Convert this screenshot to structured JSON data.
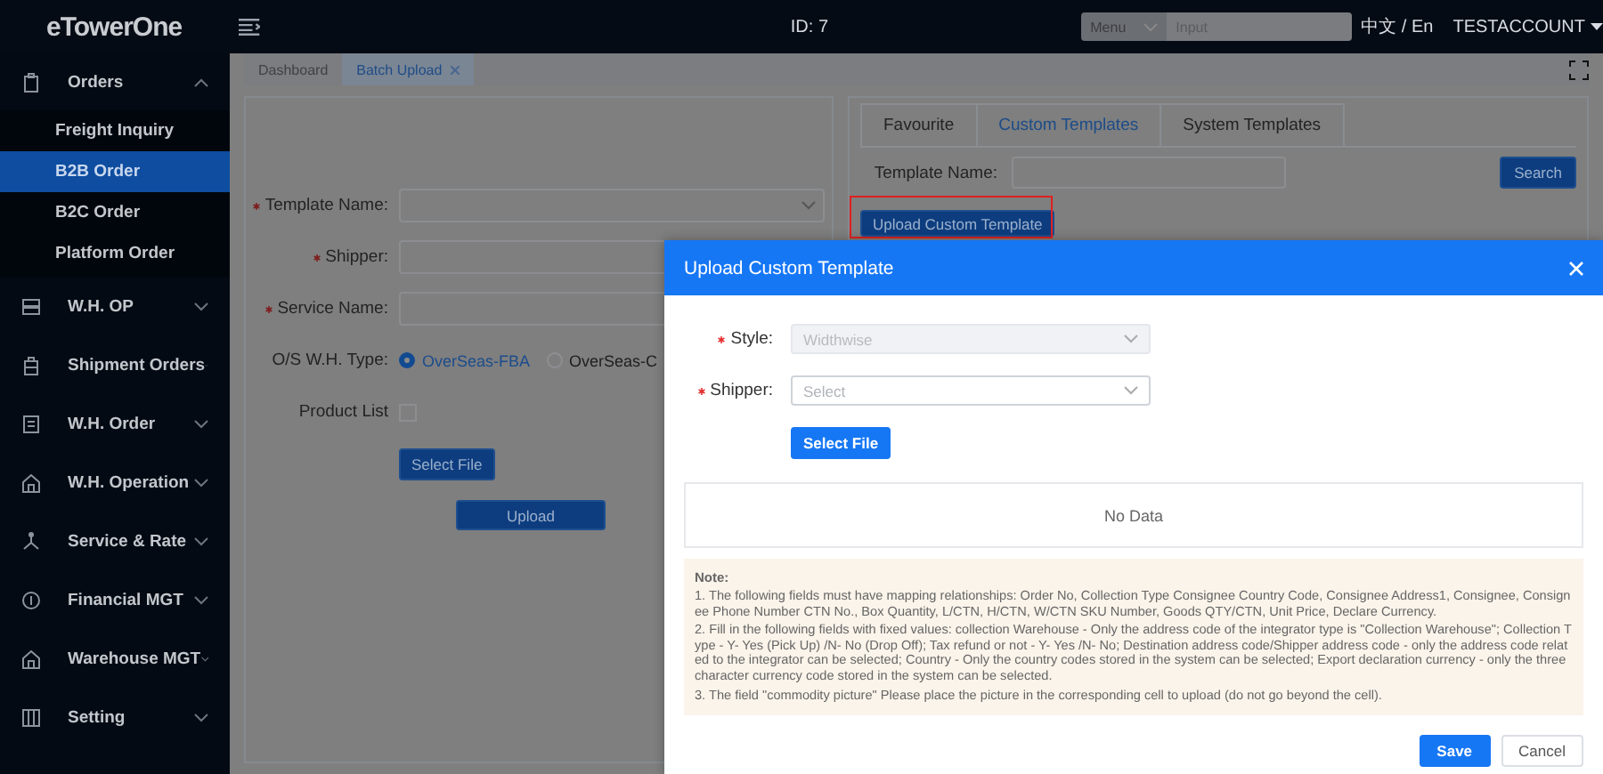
{
  "header": {
    "logo": "eTowerOne",
    "id_label": "ID: 7",
    "search": {
      "menu": "Menu",
      "placeholder": "Input"
    },
    "language": "中文 / En",
    "account": "TESTACCOUNT"
  },
  "sidebar": {
    "items": [
      {
        "label": "Orders",
        "expanded": true,
        "children": [
          {
            "label": "Freight Inquiry",
            "selected": false
          },
          {
            "label": "B2B Order",
            "selected": true
          },
          {
            "label": "B2C Order",
            "selected": false
          },
          {
            "label": "Platform Order",
            "selected": false
          }
        ]
      },
      {
        "label": "W.H. OP",
        "expanded": false
      },
      {
        "label": "Shipment Orders",
        "expanded": false
      },
      {
        "label": "W.H. Order",
        "expanded": false
      },
      {
        "label": "W.H. Operation",
        "expanded": false
      },
      {
        "label": "Service & Rate",
        "expanded": false
      },
      {
        "label": "Financial MGT",
        "expanded": false
      },
      {
        "label": "Warehouse MGT",
        "expanded": false
      },
      {
        "label": "Setting",
        "expanded": false
      }
    ]
  },
  "tabs": [
    {
      "label": "Dashboard",
      "selected": false,
      "closable": false
    },
    {
      "label": "Batch Upload",
      "selected": true,
      "closable": true
    }
  ],
  "form": {
    "fields": [
      {
        "label": "Template Name:",
        "required": true
      },
      {
        "label": "Shipper:",
        "required": true
      },
      {
        "label": "Service Name:",
        "required": true
      }
    ],
    "wh_type": {
      "label": "O/S W.H. Type:",
      "options": [
        {
          "label": "OverSeas-FBA",
          "selected": true
        },
        {
          "label": "OverSeas-C",
          "selected": false
        }
      ]
    },
    "product_list": {
      "label": "Product List",
      "checked": false
    },
    "select_file": "Select File",
    "upload": "Upload"
  },
  "templates": {
    "tabs": [
      {
        "label": "Favourite",
        "selected": false
      },
      {
        "label": "Custom Templates",
        "selected": true
      },
      {
        "label": "System Templates",
        "selected": false
      }
    ],
    "name_label": "Template Name:",
    "search": "Search",
    "upload_custom": "Upload Custom Template"
  },
  "dialog": {
    "title": "Upload Custom Template",
    "fields": [
      {
        "label": "Style:",
        "required": true,
        "value": "Widthwise",
        "disabled": true
      },
      {
        "label": "Shipper:",
        "required": true,
        "placeholder": "Select",
        "disabled": false
      }
    ],
    "select_file": "Select File",
    "empty": "No Data",
    "note_title": "Note:",
    "notes": [
      "1. The following fields must have mapping relationships: Order No, Collection Type Consignee Country Code, Consignee Address1, Consignee, Consignee Phone Number CTN No., Box Quantity, L/CTN, H/CTN, W/CTN SKU Number, Goods QTY/CTN, Unit Price, Declare Currency.",
      "2. Fill in the following fields with fixed values: collection Warehouse - Only the address code of the integrator type is \"Collection Warehouse\"; Collection Type - Y- Yes (Pick Up) /N- No (Drop Off); Tax refund or not - Y- Yes /N- No; Destination address code/Shipper address code - only the address code related to the integrator can be selected; Country - Only the country codes stored in the system can be selected; Export declaration currency - only the three character currency code stored in the system can be selected.",
      "3. The field \"commodity picture\" Please place the picture in the corresponding cell to upload (do not go beyond the cell)."
    ],
    "save": "Save",
    "cancel": "Cancel"
  }
}
